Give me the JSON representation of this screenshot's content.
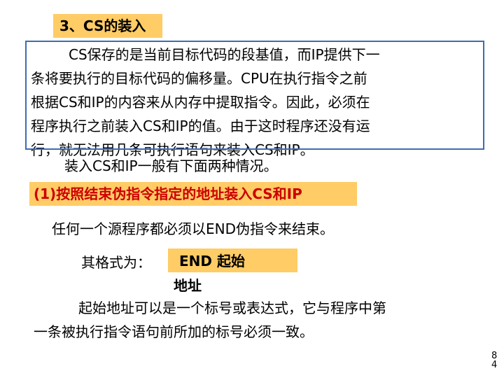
{
  "slide": {
    "section_title": "3、CS的装入",
    "paragraph_lines": [
      "CS保存的是当前目标代码的段基值，而IP提供下一",
      "条将要执行的目标代码的偏移量。CPU在执行指令之前",
      "根据CS和IP的内容来从内存中提取指令。因此，必须在",
      "程序执行之前装入CS和IP的值。由于这时程序还没有运",
      "行，就无法用几条可执行语句来装入CS和IP。"
    ],
    "cases_intro": "装入CS和IP一般有下面两种情况。",
    "case_1_heading": "(1)按照结束伪指令指定的地址装入CS和IP",
    "end_statement": "任何一个源程序都必须以END伪指令来结束。",
    "format_label": "其格式为：",
    "format_line_1": "END  起始",
    "format_line_2": "地址",
    "start_address_lines": [
      "起始地址可以是一个标号或表达式，它与程序中第",
      "一条被执行指令语句前所加的标号必须一致。"
    ],
    "page_number": "84"
  },
  "colors": {
    "highlight": "#ffcc66",
    "box_border": "#3b6db3",
    "heading_red": "#cc0000"
  }
}
